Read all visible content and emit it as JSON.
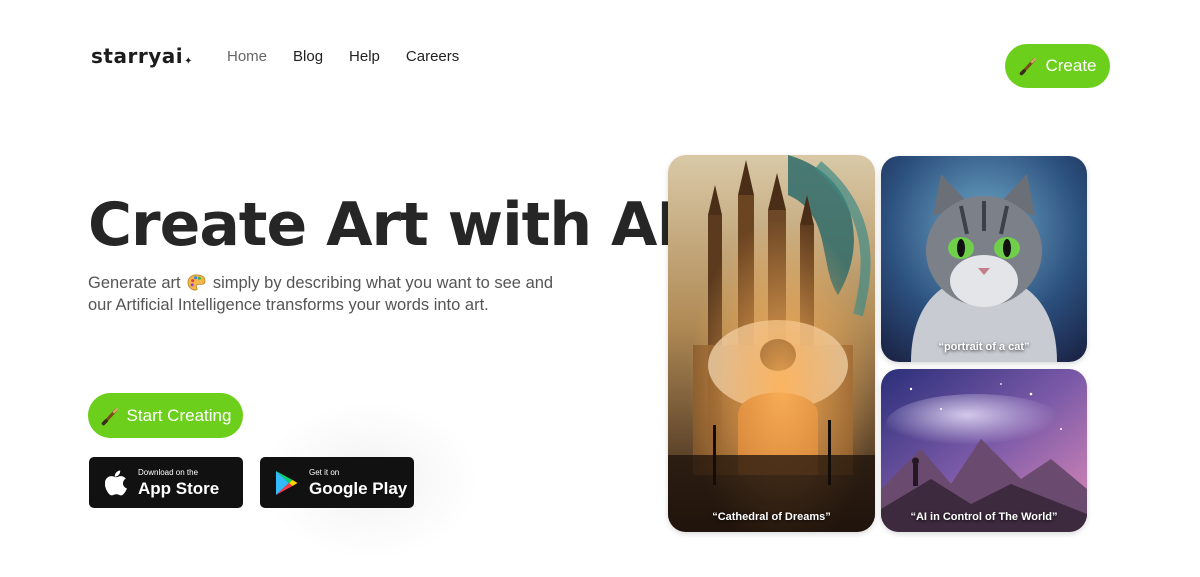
{
  "brand": {
    "name": "starryai"
  },
  "nav": [
    {
      "label": "Home",
      "active": true
    },
    {
      "label": "Blog",
      "active": false
    },
    {
      "label": "Help",
      "active": false
    },
    {
      "label": "Careers",
      "active": false
    }
  ],
  "header": {
    "create_label": "Create"
  },
  "hero": {
    "title": "Create Art with AI",
    "subtitle_part1": "Generate art",
    "subtitle_part2": "simply by describing what you want to see and our Artificial Intelligence transforms your words into art.",
    "start_label": "Start Creating"
  },
  "stores": {
    "apple": {
      "small": "Download on the",
      "big": "App Store"
    },
    "google": {
      "small": "Get it on",
      "big": "Google Play"
    }
  },
  "gallery": [
    {
      "caption": "“Cathedral of Dreams”"
    },
    {
      "caption": "“portrait of a cat”"
    },
    {
      "caption": "“AI in Control of The World”"
    }
  ],
  "colors": {
    "accent": "#6ccf1b",
    "text": "#262626",
    "store_bg": "#111111"
  },
  "icons": [
    "spark-icon",
    "brush-icon",
    "palette-emoji-icon",
    "apple-icon",
    "google-play-icon"
  ]
}
